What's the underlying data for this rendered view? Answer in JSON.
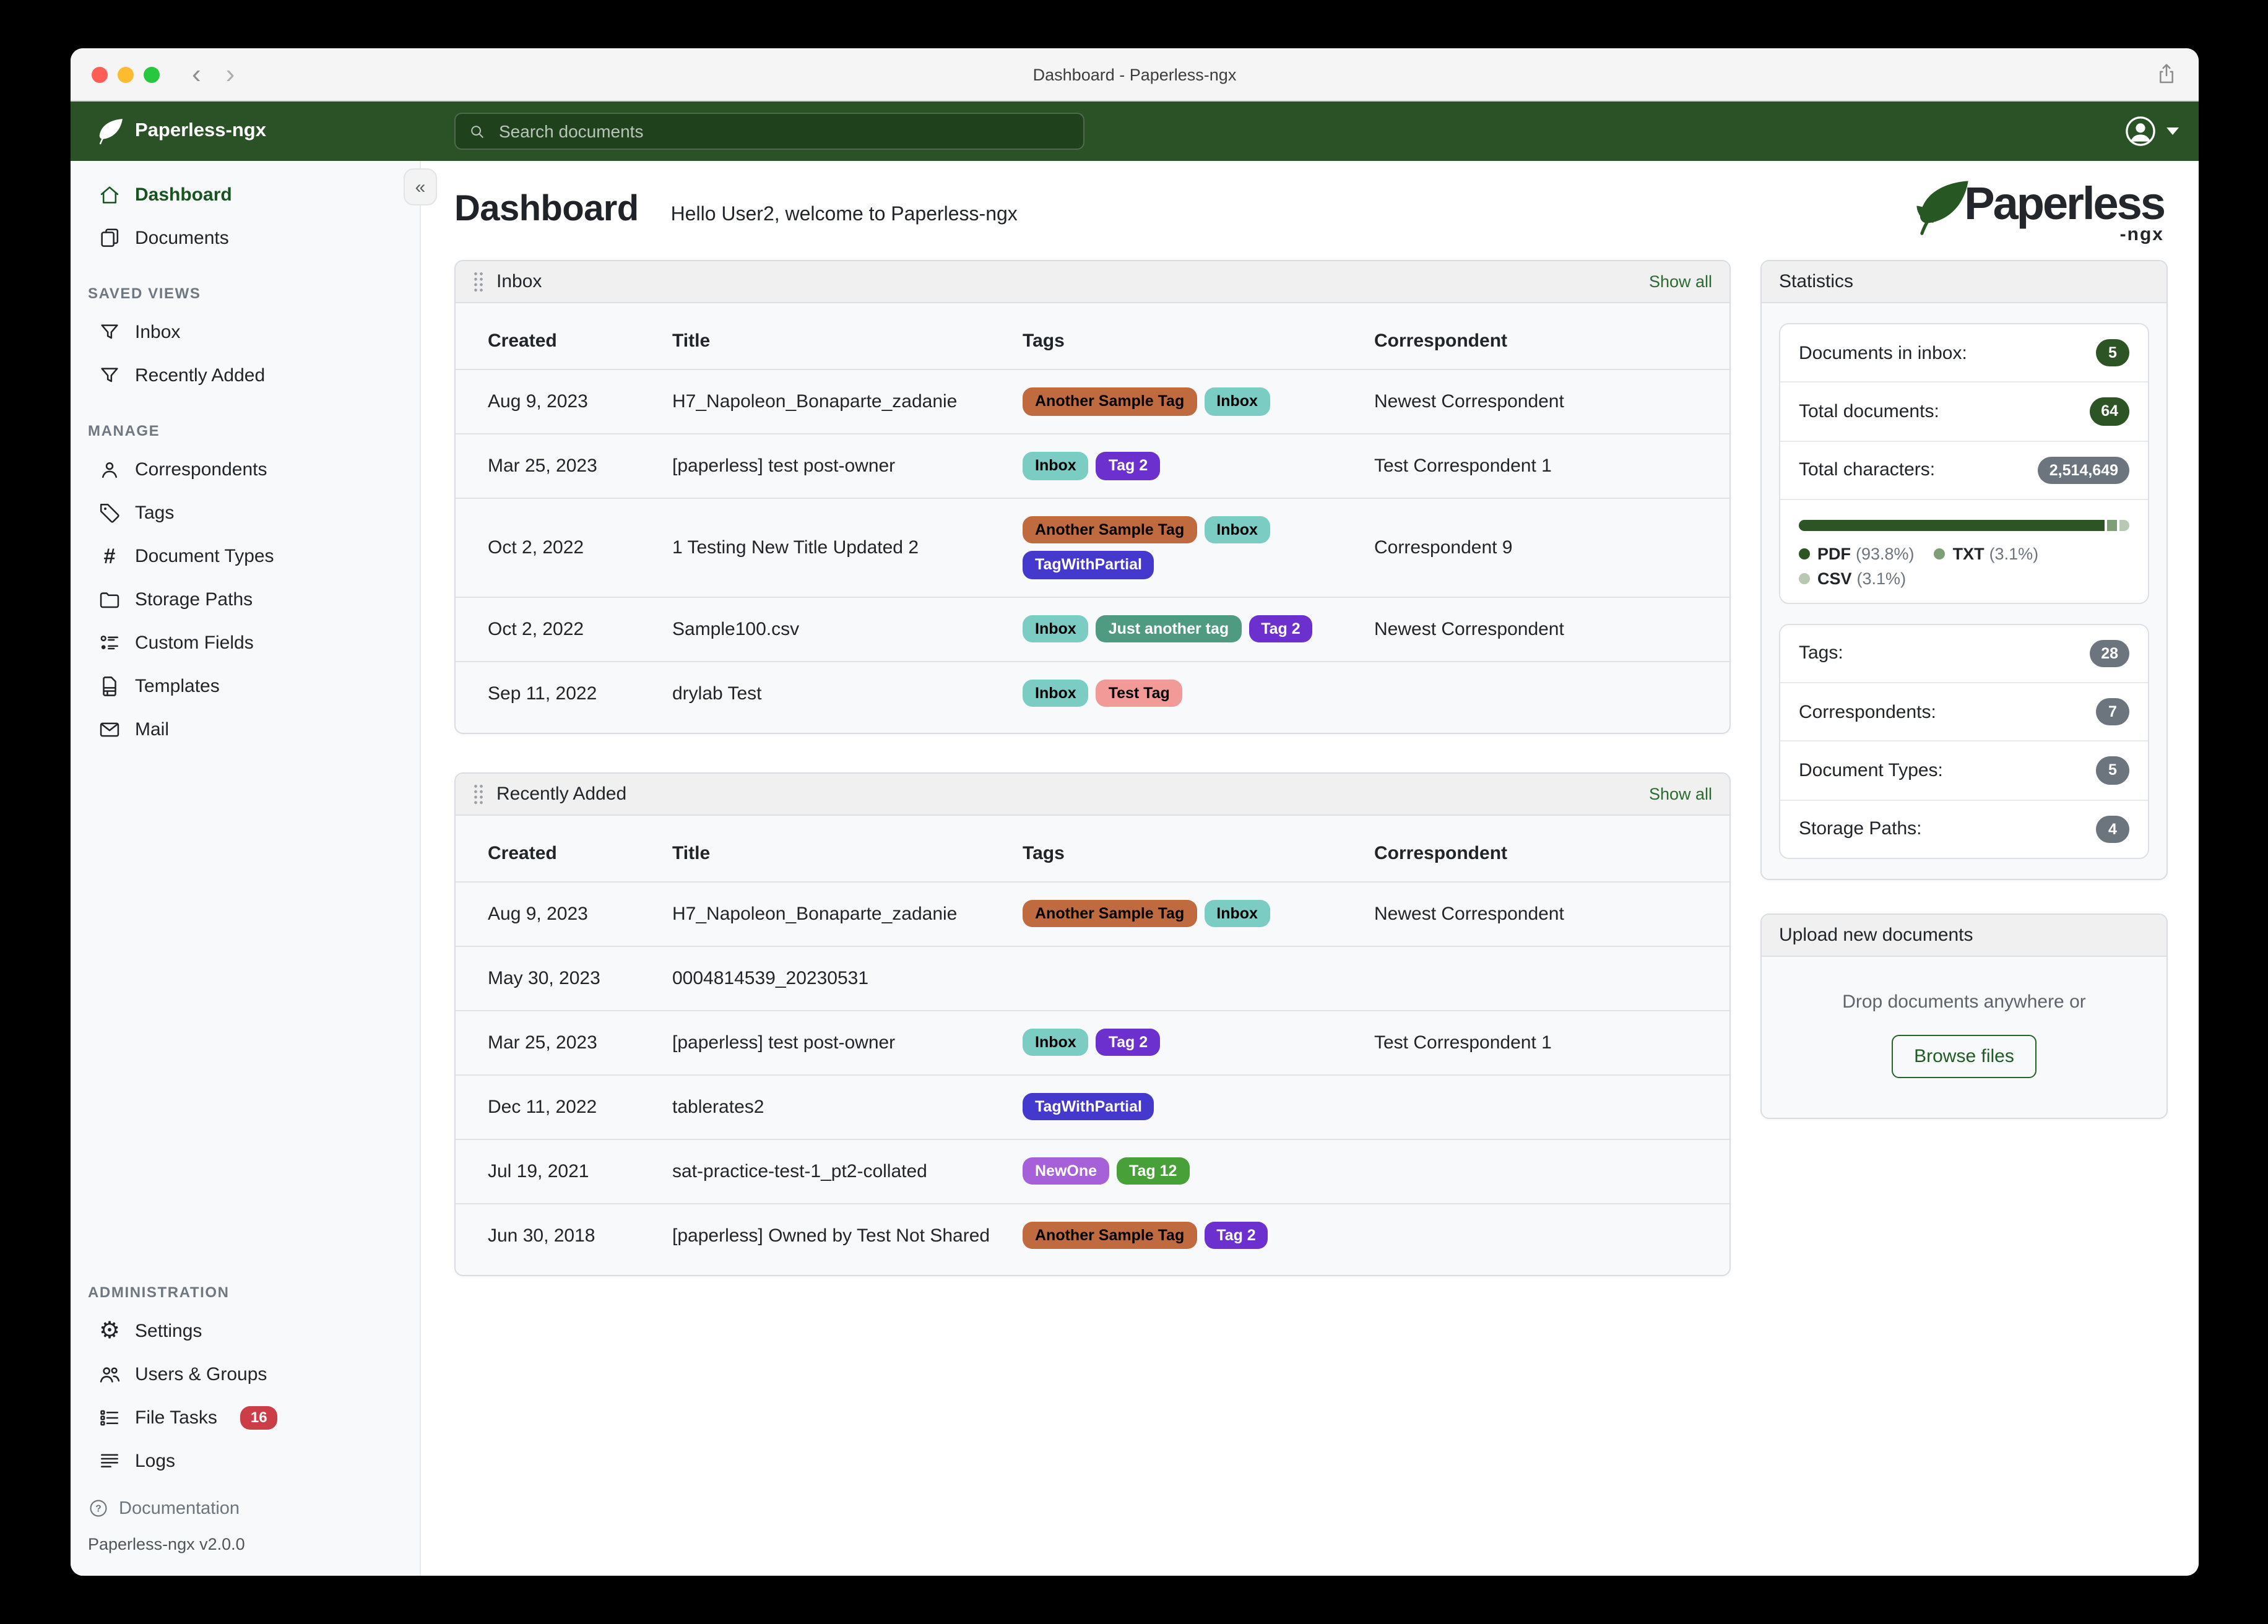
{
  "window": {
    "title": "Dashboard - Paperless-ngx"
  },
  "navbar": {
    "brand": "Paperless-ngx",
    "search_placeholder": "Search documents"
  },
  "sidebar": {
    "primary": [
      {
        "label": "Dashboard",
        "icon": "home-icon",
        "active": true
      },
      {
        "label": "Documents",
        "icon": "documents-icon",
        "active": false
      }
    ],
    "sections": [
      {
        "heading": "SAVED VIEWS",
        "items": [
          {
            "label": "Inbox",
            "icon": "filter-icon"
          },
          {
            "label": "Recently Added",
            "icon": "filter-icon"
          }
        ]
      },
      {
        "heading": "MANAGE",
        "items": [
          {
            "label": "Correspondents",
            "icon": "person-icon"
          },
          {
            "label": "Tags",
            "icon": "tag-icon"
          },
          {
            "label": "Document Types",
            "icon": "hash-icon"
          },
          {
            "label": "Storage Paths",
            "icon": "folder-icon"
          },
          {
            "label": "Custom Fields",
            "icon": "custom-fields-icon"
          },
          {
            "label": "Templates",
            "icon": "template-icon"
          },
          {
            "label": "Mail",
            "icon": "mail-icon"
          }
        ]
      },
      {
        "heading": "ADMINISTRATION",
        "items": [
          {
            "label": "Settings",
            "icon": "gear-icon"
          },
          {
            "label": "Users & Groups",
            "icon": "users-icon"
          },
          {
            "label": "File Tasks",
            "icon": "tasks-icon",
            "badge": "16"
          },
          {
            "label": "Logs",
            "icon": "logs-icon"
          }
        ]
      }
    ],
    "footer": {
      "documentation": "Documentation",
      "version": "Paperless-ngx v2.0.0"
    }
  },
  "header": {
    "title": "Dashboard",
    "greeting": "Hello User2, welcome to Paperless-ngx"
  },
  "logo": {
    "text": "Paperless",
    "suffix": "-ngx"
  },
  "columns": [
    "Created",
    "Title",
    "Tags",
    "Correspondent"
  ],
  "tag_styles": {
    "Another Sample Tag": {
      "bg": "#bf6a3f",
      "fg": "#000000"
    },
    "Inbox": {
      "bg": "#7bcdc4",
      "fg": "#000000"
    },
    "Tag 2": {
      "bg": "#6c30cf",
      "fg": "#ffffff"
    },
    "TagWithPartial": {
      "bg": "#4438cd",
      "fg": "#ffffff"
    },
    "Just another tag": {
      "bg": "#4f9b82",
      "fg": "#ffffff"
    },
    "Test Tag": {
      "bg": "#f19a97",
      "fg": "#000000"
    },
    "NewOne": {
      "bg": "#a660d8",
      "fg": "#ffffff"
    },
    "Tag 12": {
      "bg": "#48a138",
      "fg": "#ffffff"
    }
  },
  "inbox_card": {
    "title": "Inbox",
    "show_all": "Show all",
    "rows": [
      {
        "created": "Aug 9, 2023",
        "title": "H7_Napoleon_Bonaparte_zadanie",
        "tags": [
          "Another Sample Tag",
          "Inbox"
        ],
        "correspondent": "Newest Correspondent"
      },
      {
        "created": "Mar 25, 2023",
        "title": "[paperless] test post-owner",
        "tags": [
          "Inbox",
          "Tag 2"
        ],
        "correspondent": "Test Correspondent 1"
      },
      {
        "created": "Oct 2, 2022",
        "title": "1 Testing New Title Updated 2",
        "tags": [
          "Another Sample Tag",
          "Inbox",
          "TagWithPartial"
        ],
        "correspondent": "Correspondent 9"
      },
      {
        "created": "Oct 2, 2022",
        "title": "Sample100.csv",
        "tags": [
          "Inbox",
          "Just another tag",
          "Tag 2"
        ],
        "correspondent": "Newest Correspondent"
      },
      {
        "created": "Sep 11, 2022",
        "title": "drylab Test",
        "tags": [
          "Inbox",
          "Test Tag"
        ],
        "correspondent": ""
      }
    ]
  },
  "recent_card": {
    "title": "Recently Added",
    "show_all": "Show all",
    "rows": [
      {
        "created": "Aug 9, 2023",
        "title": "H7_Napoleon_Bonaparte_zadanie",
        "tags": [
          "Another Sample Tag",
          "Inbox"
        ],
        "correspondent": "Newest Correspondent"
      },
      {
        "created": "May 30, 2023",
        "title": "0004814539_20230531",
        "tags": [],
        "correspondent": ""
      },
      {
        "created": "Mar 25, 2023",
        "title": "[paperless] test post-owner",
        "tags": [
          "Inbox",
          "Tag 2"
        ],
        "correspondent": "Test Correspondent 1"
      },
      {
        "created": "Dec 11, 2022",
        "title": "tablerates2",
        "tags": [
          "TagWithPartial"
        ],
        "correspondent": ""
      },
      {
        "created": "Jul 19, 2021",
        "title": "sat-practice-test-1_pt2-collated",
        "tags": [
          "NewOne",
          "Tag 12"
        ],
        "correspondent": ""
      },
      {
        "created": "Jun 30, 2018",
        "title": "[paperless] Owned by Test Not Shared",
        "tags": [
          "Another Sample Tag",
          "Tag 2"
        ],
        "correspondent": ""
      }
    ]
  },
  "statistics": {
    "title": "Statistics",
    "summary": [
      {
        "label": "Documents in inbox:",
        "value": "5",
        "badge": "green"
      },
      {
        "label": "Total documents:",
        "value": "64",
        "badge": "green"
      },
      {
        "label": "Total characters:",
        "value": "2,514,649",
        "badge": "gray"
      }
    ],
    "file_types": {
      "type": "bar",
      "segments": [
        {
          "label": "PDF",
          "pct": 93.8,
          "pct_text": "(93.8%)",
          "color": "#2c5424"
        },
        {
          "label": "TXT",
          "pct": 3.1,
          "pct_text": "(3.1%)",
          "color": "#7f9e78"
        },
        {
          "label": "CSV",
          "pct": 3.1,
          "pct_text": "(3.1%)",
          "color": "#b9c8b2"
        }
      ]
    },
    "counts": [
      {
        "label": "Tags:",
        "value": "28",
        "badge": "gray"
      },
      {
        "label": "Correspondents:",
        "value": "7",
        "badge": "gray"
      },
      {
        "label": "Document Types:",
        "value": "5",
        "badge": "gray"
      },
      {
        "label": "Storage Paths:",
        "value": "4",
        "badge": "gray"
      }
    ]
  },
  "upload": {
    "title": "Upload new documents",
    "hint": "Drop documents anywhere or",
    "button": "Browse files"
  },
  "colors": {
    "accent_green": "#17541f",
    "navbar_green": "#2a5226",
    "badge_green": "#2c5424",
    "badge_gray": "#6c757d",
    "danger_red": "#cb3e47"
  }
}
